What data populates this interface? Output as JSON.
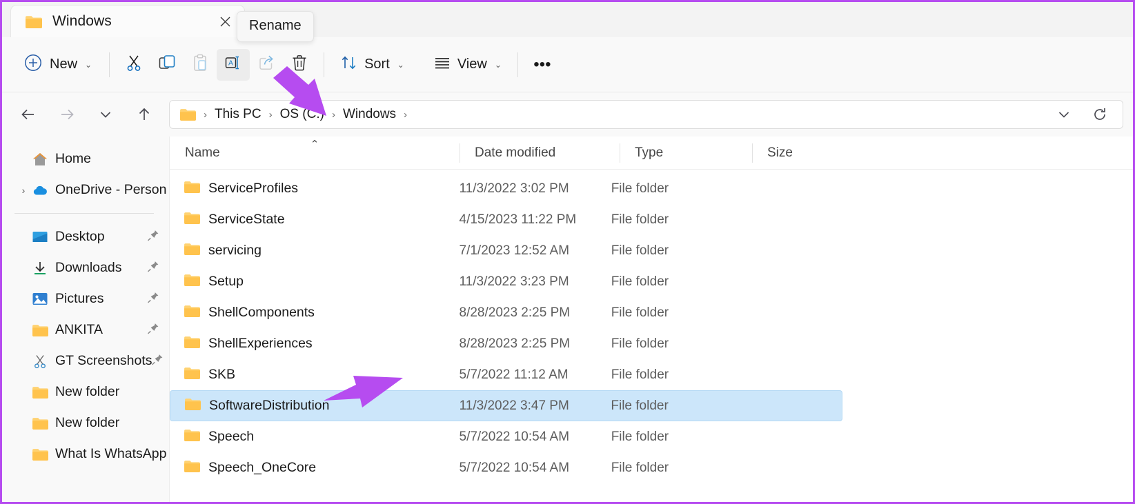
{
  "window": {
    "tab_title": "Windows",
    "tab_icon": "folder-icon",
    "close_icon": "close-icon"
  },
  "tooltip": {
    "text": "Rename"
  },
  "toolbar": {
    "new_label": "New",
    "new_icon": "plus-circle-icon",
    "cut_icon": "scissors-icon",
    "copy_icon": "copy-icon",
    "paste_icon": "clipboard-paste-icon",
    "rename_icon": "rename-icon",
    "share_icon": "share-icon",
    "delete_icon": "trash-icon",
    "sort_label": "Sort",
    "sort_icon": "sort-arrows-icon",
    "view_label": "View",
    "view_icon": "list-lines-icon",
    "more_label": "•••",
    "chevron": "⌄"
  },
  "navigation": {
    "back_icon": "arrow-left-icon",
    "forward_icon": "arrow-right-icon",
    "recent_icon": "chevron-down-icon",
    "up_icon": "arrow-up-icon",
    "breadcrumb_icon": "folder-icon",
    "breadcrumbs": [
      "This PC",
      "OS (C:)",
      "Windows"
    ],
    "separator": "›",
    "dropdown_icon": "chevron-down-icon",
    "refresh_icon": "refresh-icon"
  },
  "sidebar": {
    "items": [
      {
        "label": "Home",
        "icon": "home-icon",
        "pinned": false,
        "expandable": false
      },
      {
        "label": "OneDrive - Person",
        "icon": "cloud-icon",
        "pinned": false,
        "expandable": true
      },
      {
        "label": "Desktop",
        "icon": "desktop-icon",
        "pinned": true,
        "expandable": false
      },
      {
        "label": "Downloads",
        "icon": "download-icon",
        "pinned": true,
        "expandable": false
      },
      {
        "label": "Pictures",
        "icon": "pictures-icon",
        "pinned": true,
        "expandable": false
      },
      {
        "label": "ANKITA",
        "icon": "folder-icon",
        "pinned": true,
        "expandable": false
      },
      {
        "label": "GT Screenshots",
        "icon": "scissors-icon",
        "pinned": true,
        "expandable": false
      },
      {
        "label": "New folder",
        "icon": "folder-icon",
        "pinned": false,
        "expandable": false
      },
      {
        "label": "New folder",
        "icon": "folder-icon",
        "pinned": false,
        "expandable": false
      },
      {
        "label": "What Is WhatsApp",
        "icon": "folder-icon",
        "pinned": false,
        "expandable": false
      }
    ]
  },
  "filelist": {
    "columns": [
      "Name",
      "Date modified",
      "Type",
      "Size"
    ],
    "sort_column": "Name",
    "sort_direction": "ascending",
    "rows": [
      {
        "name": "ServiceProfiles",
        "date": "11/3/2022 3:02 PM",
        "type": "File folder",
        "size": "",
        "selected": false
      },
      {
        "name": "ServiceState",
        "date": "4/15/2023 11:22 PM",
        "type": "File folder",
        "size": "",
        "selected": false
      },
      {
        "name": "servicing",
        "date": "7/1/2023 12:52 AM",
        "type": "File folder",
        "size": "",
        "selected": false
      },
      {
        "name": "Setup",
        "date": "11/3/2022 3:23 PM",
        "type": "File folder",
        "size": "",
        "selected": false
      },
      {
        "name": "ShellComponents",
        "date": "8/28/2023 2:25 PM",
        "type": "File folder",
        "size": "",
        "selected": false
      },
      {
        "name": "ShellExperiences",
        "date": "8/28/2023 2:25 PM",
        "type": "File folder",
        "size": "",
        "selected": false
      },
      {
        "name": "SKB",
        "date": "5/7/2022 11:12 AM",
        "type": "File folder",
        "size": "",
        "selected": false
      },
      {
        "name": "SoftwareDistribution",
        "date": "11/3/2022 3:47 PM",
        "type": "File folder",
        "size": "",
        "selected": true
      },
      {
        "name": "Speech",
        "date": "5/7/2022 10:54 AM",
        "type": "File folder",
        "size": "",
        "selected": false
      },
      {
        "name": "Speech_OneCore",
        "date": "5/7/2022 10:54 AM",
        "type": "File folder",
        "size": "",
        "selected": false
      }
    ]
  },
  "annotations": {
    "arrow_color": "#b64cf0",
    "border_color": "#b64cf0",
    "arrows": [
      {
        "name": "arrow-to-rename-button",
        "points_at": "rename-button"
      },
      {
        "name": "arrow-to-selected-folder",
        "points_at": "SoftwareDistribution"
      }
    ]
  },
  "colors": {
    "accent": "#0f6cbd",
    "selection": "#cce6fa",
    "folder": "#ffd271",
    "annotation": "#b64cf0"
  }
}
